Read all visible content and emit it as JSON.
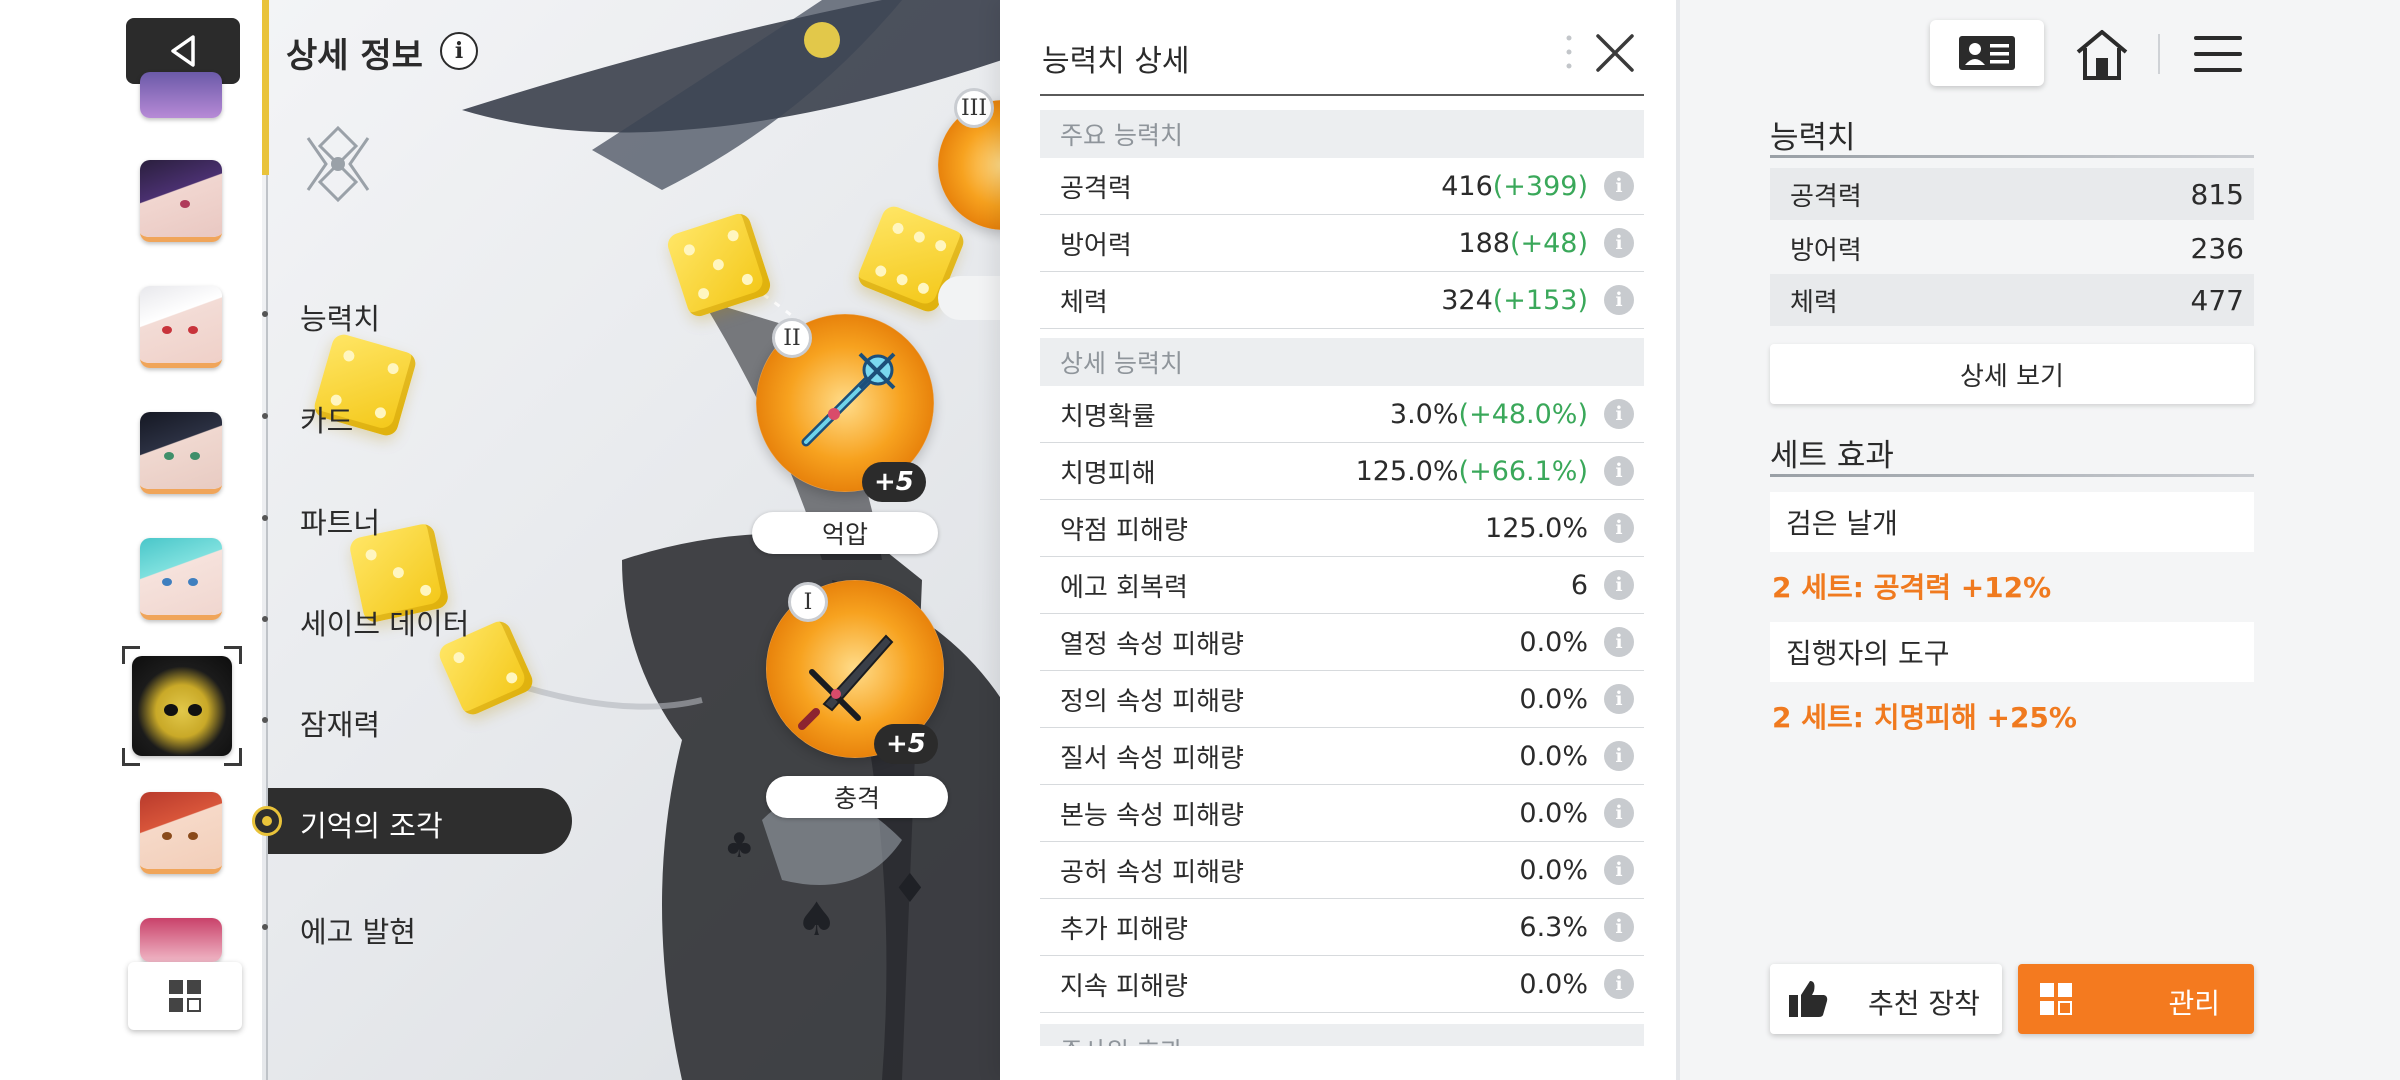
{
  "nav": {
    "page_title": "상세 정보",
    "info_glyph": "i",
    "menu": [
      {
        "label": "능력치"
      },
      {
        "label": "카드"
      },
      {
        "label": "파트너"
      },
      {
        "label": "세이브 데이터"
      },
      {
        "label": "잠재력"
      },
      {
        "label": "기억의 조각",
        "active": true
      },
      {
        "label": "에고 발현"
      }
    ],
    "accent_color": "#e9c33a"
  },
  "fragments": [
    {
      "slot": "II",
      "level": "+5",
      "name": "억압"
    },
    {
      "slot": "I",
      "level": "+5",
      "name": "충격"
    },
    {
      "slot": "III"
    }
  ],
  "stats_panel": {
    "title": "능력치 상세",
    "main_section": "주요 능력치",
    "main_stats": [
      {
        "label": "공격력",
        "value": "416",
        "bonus": "(+399)"
      },
      {
        "label": "방어력",
        "value": "188",
        "bonus": "(+48)"
      },
      {
        "label": "체력",
        "value": "324",
        "bonus": "(+153)"
      }
    ],
    "detail_section": "상세 능력치",
    "detail_stats": [
      {
        "label": "치명확률",
        "value": "3.0%",
        "bonus": "(+48.0%)"
      },
      {
        "label": "치명피해",
        "value": "125.0%",
        "bonus": "(+66.1%)"
      },
      {
        "label": "약점 피해량",
        "value": "125.0%",
        "bonus": ""
      },
      {
        "label": "에고 회복력",
        "value": "6",
        "bonus": ""
      },
      {
        "label": "열정 속성 피해량",
        "value": "0.0%",
        "bonus": ""
      },
      {
        "label": "정의 속성 피해량",
        "value": "0.0%",
        "bonus": ""
      },
      {
        "label": "질서 속성 피해량",
        "value": "0.0%",
        "bonus": ""
      },
      {
        "label": "본능 속성 피해량",
        "value": "0.0%",
        "bonus": ""
      },
      {
        "label": "공허 속성 피해량",
        "value": "0.0%",
        "bonus": ""
      },
      {
        "label": "추가 피해량",
        "value": "6.3%",
        "bonus": ""
      },
      {
        "label": "지속 피해량",
        "value": "0.0%",
        "bonus": ""
      }
    ],
    "cut_section": "주사위 효과",
    "bonus_color": "#3aa85a",
    "info_glyph": "i"
  },
  "summary": {
    "stats_heading": "능력치",
    "stats": [
      {
        "label": "공격력",
        "value": "815"
      },
      {
        "label": "방어력",
        "value": "236"
      },
      {
        "label": "체력",
        "value": "477"
      }
    ],
    "detail_button": "상세 보기",
    "set_heading": "세트 효과",
    "sets": [
      {
        "name": "검은 날개",
        "effect": "2 세트: 공격력 +12%"
      },
      {
        "name": "집행자의 도구",
        "effect": "2 세트: 치명피해 +25%"
      }
    ],
    "recommend_button": "추천 장착",
    "manage_button": "관리",
    "effect_color": "#f07a1f",
    "manage_color": "#f47a1f"
  },
  "icons": [
    "back-icon",
    "info-icon",
    "grid-icon",
    "close-icon",
    "more-dots-icon",
    "profile-card-icon",
    "home-icon",
    "hamburger-menu-icon",
    "thumbs-up-icon",
    "manage-grid-icon"
  ]
}
